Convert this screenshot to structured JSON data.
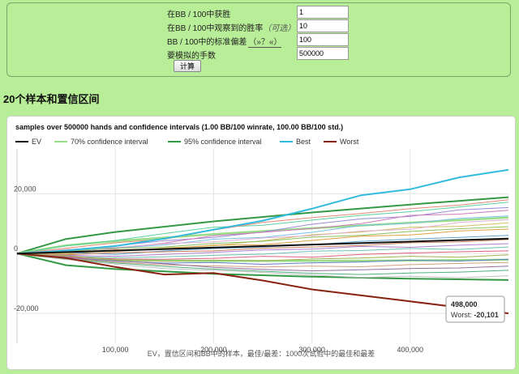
{
  "form": {
    "rows": [
      {
        "label": "在BB / 100中获胜",
        "value": "1"
      },
      {
        "label": "在BB / 100中观察到的胜率",
        "optional": "（可选）",
        "value": "10"
      },
      {
        "label": "BB / 100中的标准偏差",
        "help": "（»？«）",
        "value": "100"
      },
      {
        "label": "要模拟的手数",
        "value": "500000"
      }
    ],
    "calc_button": "计算"
  },
  "section_title": "20个样本和置信区间",
  "chart_data": {
    "type": "line",
    "title": "samples over 500000 hands and confidence intervals (1.00 BB/100 winrate, 100.00 BB/100 std.)",
    "xlabel": "EV，置信区间和BB中的样本，最佳/最差：1000次试验中的最佳和最差",
    "ylabel": "",
    "xlim": [
      0,
      500000
    ],
    "ylim": [
      -30000,
      35000
    ],
    "x_ticks": [
      100000,
      200000,
      300000,
      400000
    ],
    "x_tick_labels": [
      "100,000",
      "200,000",
      "300,000",
      "400,000"
    ],
    "y_ticks": [
      20000,
      0,
      -20000
    ],
    "y_tick_labels": [
      "20,000",
      "0",
      "-20,000"
    ],
    "grid": true,
    "legend_placement": "top-left",
    "legend": [
      {
        "name": "EV",
        "color": "#111111"
      },
      {
        "name": "70% confidence interval",
        "color": "#99dd88"
      },
      {
        "name": "95% confidence interval",
        "color": "#339944"
      },
      {
        "name": "Best",
        "color": "#33bbdd"
      },
      {
        "name": "Worst",
        "color": "#882211"
      }
    ],
    "ev": {
      "x": [
        0,
        500000
      ],
      "y": [
        0,
        5000
      ]
    },
    "ci70": {
      "x": [
        0,
        50000,
        100000,
        200000,
        300000,
        400000,
        500000
      ],
      "upper": [
        0,
        2750,
        4160,
        6470,
        8460,
        10320,
        12070
      ],
      "lower": [
        0,
        -1750,
        -2160,
        -2470,
        -2460,
        -2320,
        -2070
      ]
    },
    "ci95": {
      "x": [
        0,
        50000,
        100000,
        200000,
        300000,
        400000,
        500000
      ],
      "upper": [
        0,
        4880,
        7200,
        10760,
        13740,
        16400,
        18860
      ],
      "lower": [
        0,
        -3880,
        -5200,
        -6760,
        -7740,
        -8400,
        -8860
      ]
    },
    "best": {
      "x": [
        0,
        50000,
        100000,
        150000,
        200000,
        250000,
        300000,
        350000,
        400000,
        450000,
        500000
      ],
      "y": [
        0,
        1000,
        2500,
        5000,
        8000,
        11000,
        15000,
        19500,
        21500,
        25500,
        28000
      ]
    },
    "worst": {
      "x": [
        0,
        50000,
        100000,
        150000,
        200000,
        250000,
        300000,
        350000,
        400000,
        450000,
        500000
      ],
      "y": [
        0,
        -1500,
        -4500,
        -7000,
        -6500,
        -9000,
        -12000,
        -14000,
        -16000,
        -18000,
        -20000
      ]
    },
    "samples": [
      {
        "color": "#5cd0a0",
        "y": [
          0,
          2600,
          4400,
          6700,
          8800,
          9500,
          11200,
          12800,
          14000,
          15600,
          17200
        ]
      },
      {
        "color": "#e08a70",
        "y": [
          0,
          1800,
          3600,
          4800,
          7900,
          10400,
          12000,
          13400,
          15000,
          16200,
          18000
        ]
      },
      {
        "color": "#9a8ad8",
        "y": [
          0,
          1200,
          2600,
          4300,
          5400,
          7200,
          9800,
          11600,
          12400,
          14600,
          15400
        ]
      },
      {
        "color": "#d07ab8",
        "y": [
          0,
          900,
          1600,
          3500,
          6000,
          7100,
          8400,
          10000,
          12800,
          13200,
          14500
        ]
      },
      {
        "color": "#7bbfe8",
        "y": [
          0,
          600,
          1900,
          2900,
          4800,
          5400,
          7100,
          9400,
          10100,
          11800,
          12600
        ]
      },
      {
        "color": "#d0c060",
        "y": [
          0,
          200,
          700,
          1900,
          2600,
          4300,
          6300,
          7200,
          8800,
          9100,
          10300
        ]
      },
      {
        "color": "#8cc060",
        "y": [
          0,
          800,
          1800,
          2200,
          3400,
          4100,
          5500,
          6100,
          7400,
          8300,
          9000
        ]
      },
      {
        "color": "#e0a040",
        "y": [
          0,
          -200,
          1200,
          1600,
          2800,
          3000,
          4400,
          5800,
          6200,
          7600,
          8200
        ]
      },
      {
        "color": "#60a0d0",
        "y": [
          0,
          400,
          -300,
          900,
          1700,
          2200,
          3000,
          4100,
          4800,
          5400,
          6100
        ]
      },
      {
        "color": "#c88060",
        "y": [
          0,
          -400,
          300,
          600,
          900,
          1800,
          2200,
          2700,
          3600,
          3900,
          4700
        ]
      },
      {
        "color": "#b080d0",
        "y": [
          0,
          -600,
          -900,
          -300,
          400,
          1200,
          1500,
          2400,
          2100,
          2800,
          3300
        ]
      },
      {
        "color": "#70c0b0",
        "y": [
          0,
          -900,
          -1400,
          -1100,
          -600,
          -200,
          800,
          1000,
          1700,
          1400,
          2200
        ]
      },
      {
        "color": "#e06080",
        "y": [
          0,
          -1100,
          -1800,
          -1900,
          -1600,
          -900,
          -1200,
          -300,
          200,
          600,
          900
        ]
      },
      {
        "color": "#a0b050",
        "y": [
          0,
          -700,
          -2100,
          -2600,
          -2200,
          -2400,
          -1800,
          -1500,
          -900,
          -1200,
          -400
        ]
      },
      {
        "color": "#6080c0",
        "y": [
          0,
          -1400,
          -2500,
          -3200,
          -3000,
          -3600,
          -3100,
          -2800,
          -2200,
          -2500,
          -1900
        ]
      },
      {
        "color": "#d0a080",
        "y": [
          0,
          -1600,
          -2900,
          -3800,
          -4100,
          -4500,
          -4200,
          -4400,
          -3700,
          -3300,
          -3000
        ]
      },
      {
        "color": "#9070a0",
        "y": [
          0,
          -1300,
          -2400,
          -3400,
          -4600,
          -5300,
          -5800,
          -5400,
          -5000,
          -4800,
          -4200
        ]
      },
      {
        "color": "#50b080",
        "y": [
          0,
          -1800,
          -3100,
          -4300,
          -5200,
          -5900,
          -6600,
          -7000,
          -6500,
          -6200,
          -5600
        ]
      },
      {
        "color": "#c0c0c0",
        "y": [
          0,
          -2000,
          -3500,
          -5000,
          -5600,
          -6300,
          -7200,
          -8000,
          -7600,
          -8100,
          -7400
        ]
      },
      {
        "color": "#e0b0d0",
        "y": [
          0,
          1400,
          2000,
          3300,
          3900,
          5200,
          6000,
          7500,
          8100,
          10400,
          11300
        ]
      }
    ],
    "tooltip": {
      "x_label": "498,000",
      "series": "Worst",
      "value": "-20,101"
    }
  }
}
